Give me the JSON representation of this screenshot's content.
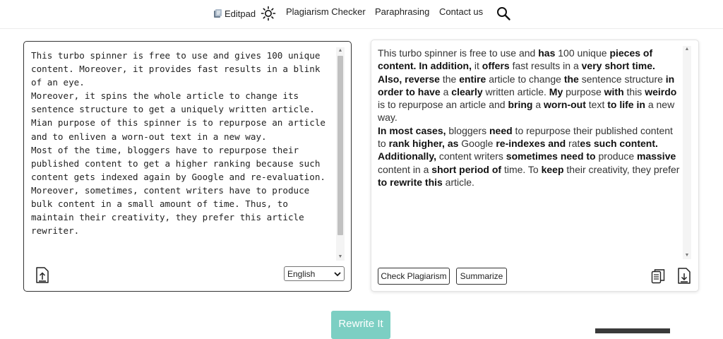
{
  "header": {
    "brand": "Editpad",
    "nav": [
      "Plagiarism Checker",
      "Paraphrasing",
      "Contact us"
    ],
    "icons": [
      "editpad-logo-icon",
      "sun-icon",
      "search-icon"
    ]
  },
  "input": {
    "text": "This turbo spinner is free to use and gives 100 unique content. Moreover, it provides fast results in a blink of an eye.\nMoreover, it spins the whole article to change its sentence structure to get a uniquely written article. Mian purpose of this spinner is to repurpose an article and to enliven a worn-out text in a new way.\nMost of the time, bloggers have to repurpose their published content to get a higher ranking because such content gets indexed again by Google and re-evaluation.\nMoreover, sometimes, content writers have to produce bulk content in a small amount of time. Thus, to maintain their creativity, they prefer this article rewriter.",
    "language": "English"
  },
  "output": {
    "segments": [
      {
        "t": "This turbo spinner is free to use and ",
        "b": false
      },
      {
        "t": "has",
        "b": true
      },
      {
        "t": " 100 unique ",
        "b": false
      },
      {
        "t": "pieces of content. In addition,",
        "b": true
      },
      {
        "t": " it ",
        "b": false
      },
      {
        "t": "offers",
        "b": true
      },
      {
        "t": " fast results in a ",
        "b": false
      },
      {
        "t": "very short time.",
        "b": true
      },
      {
        "t": "\n ",
        "b": false
      },
      {
        "t": "Also, reverse",
        "b": true
      },
      {
        "t": " the ",
        "b": false
      },
      {
        "t": "entire",
        "b": true
      },
      {
        "t": " article to change ",
        "b": false
      },
      {
        "t": "the",
        "b": true
      },
      {
        "t": " sentence structure ",
        "b": false
      },
      {
        "t": "in order to have",
        "b": true
      },
      {
        "t": " a ",
        "b": false
      },
      {
        "t": "clearly",
        "b": true
      },
      {
        "t": " written article. ",
        "b": false
      },
      {
        "t": "My",
        "b": true
      },
      {
        "t": " purpose ",
        "b": false
      },
      {
        "t": "with",
        "b": true
      },
      {
        "t": " this ",
        "b": false
      },
      {
        "t": "weirdo",
        "b": true
      },
      {
        "t": " is to repurpose an article and ",
        "b": false
      },
      {
        "t": "bring",
        "b": true
      },
      {
        "t": " a ",
        "b": false
      },
      {
        "t": "worn-out",
        "b": true
      },
      {
        "t": " text ",
        "b": false
      },
      {
        "t": "to life in",
        "b": true
      },
      {
        "t": " a new way.",
        "b": false
      },
      {
        "t": "\n ",
        "b": false
      },
      {
        "t": "In most cases,",
        "b": true
      },
      {
        "t": " bloggers ",
        "b": false
      },
      {
        "t": "need",
        "b": true
      },
      {
        "t": " to repurpose their published content to ",
        "b": false
      },
      {
        "t": "rank higher, as",
        "b": true
      },
      {
        "t": " Google ",
        "b": false
      },
      {
        "t": "re-indexes and",
        "b": true
      },
      {
        "t": " rat",
        "b": false
      },
      {
        "t": "es such content.",
        "b": true
      },
      {
        "t": "\n ",
        "b": false
      },
      {
        "t": "Additionally,",
        "b": true
      },
      {
        "t": " content writers ",
        "b": false
      },
      {
        "t": "sometimes need to",
        "b": true
      },
      {
        "t": " produce ",
        "b": false
      },
      {
        "t": "massive",
        "b": true
      },
      {
        "t": " content in a ",
        "b": false
      },
      {
        "t": "short period of",
        "b": true
      },
      {
        "t": " time. To ",
        "b": false
      },
      {
        "t": "keep",
        "b": true
      },
      {
        "t": " their creativity, they prefer ",
        "b": false
      },
      {
        "t": "to rewrite this",
        "b": true
      },
      {
        "t": " article.",
        "b": false
      }
    ],
    "buttons": {
      "check_plagiarism": "Check Plagiarism",
      "summarize": "Summarize"
    },
    "icons": [
      "copy-icon",
      "download-icon"
    ]
  },
  "actions": {
    "rewrite": "Rewrite It"
  },
  "colors": {
    "accent": "#7ccfc3",
    "border_dark": "#333333",
    "text": "#222222"
  }
}
